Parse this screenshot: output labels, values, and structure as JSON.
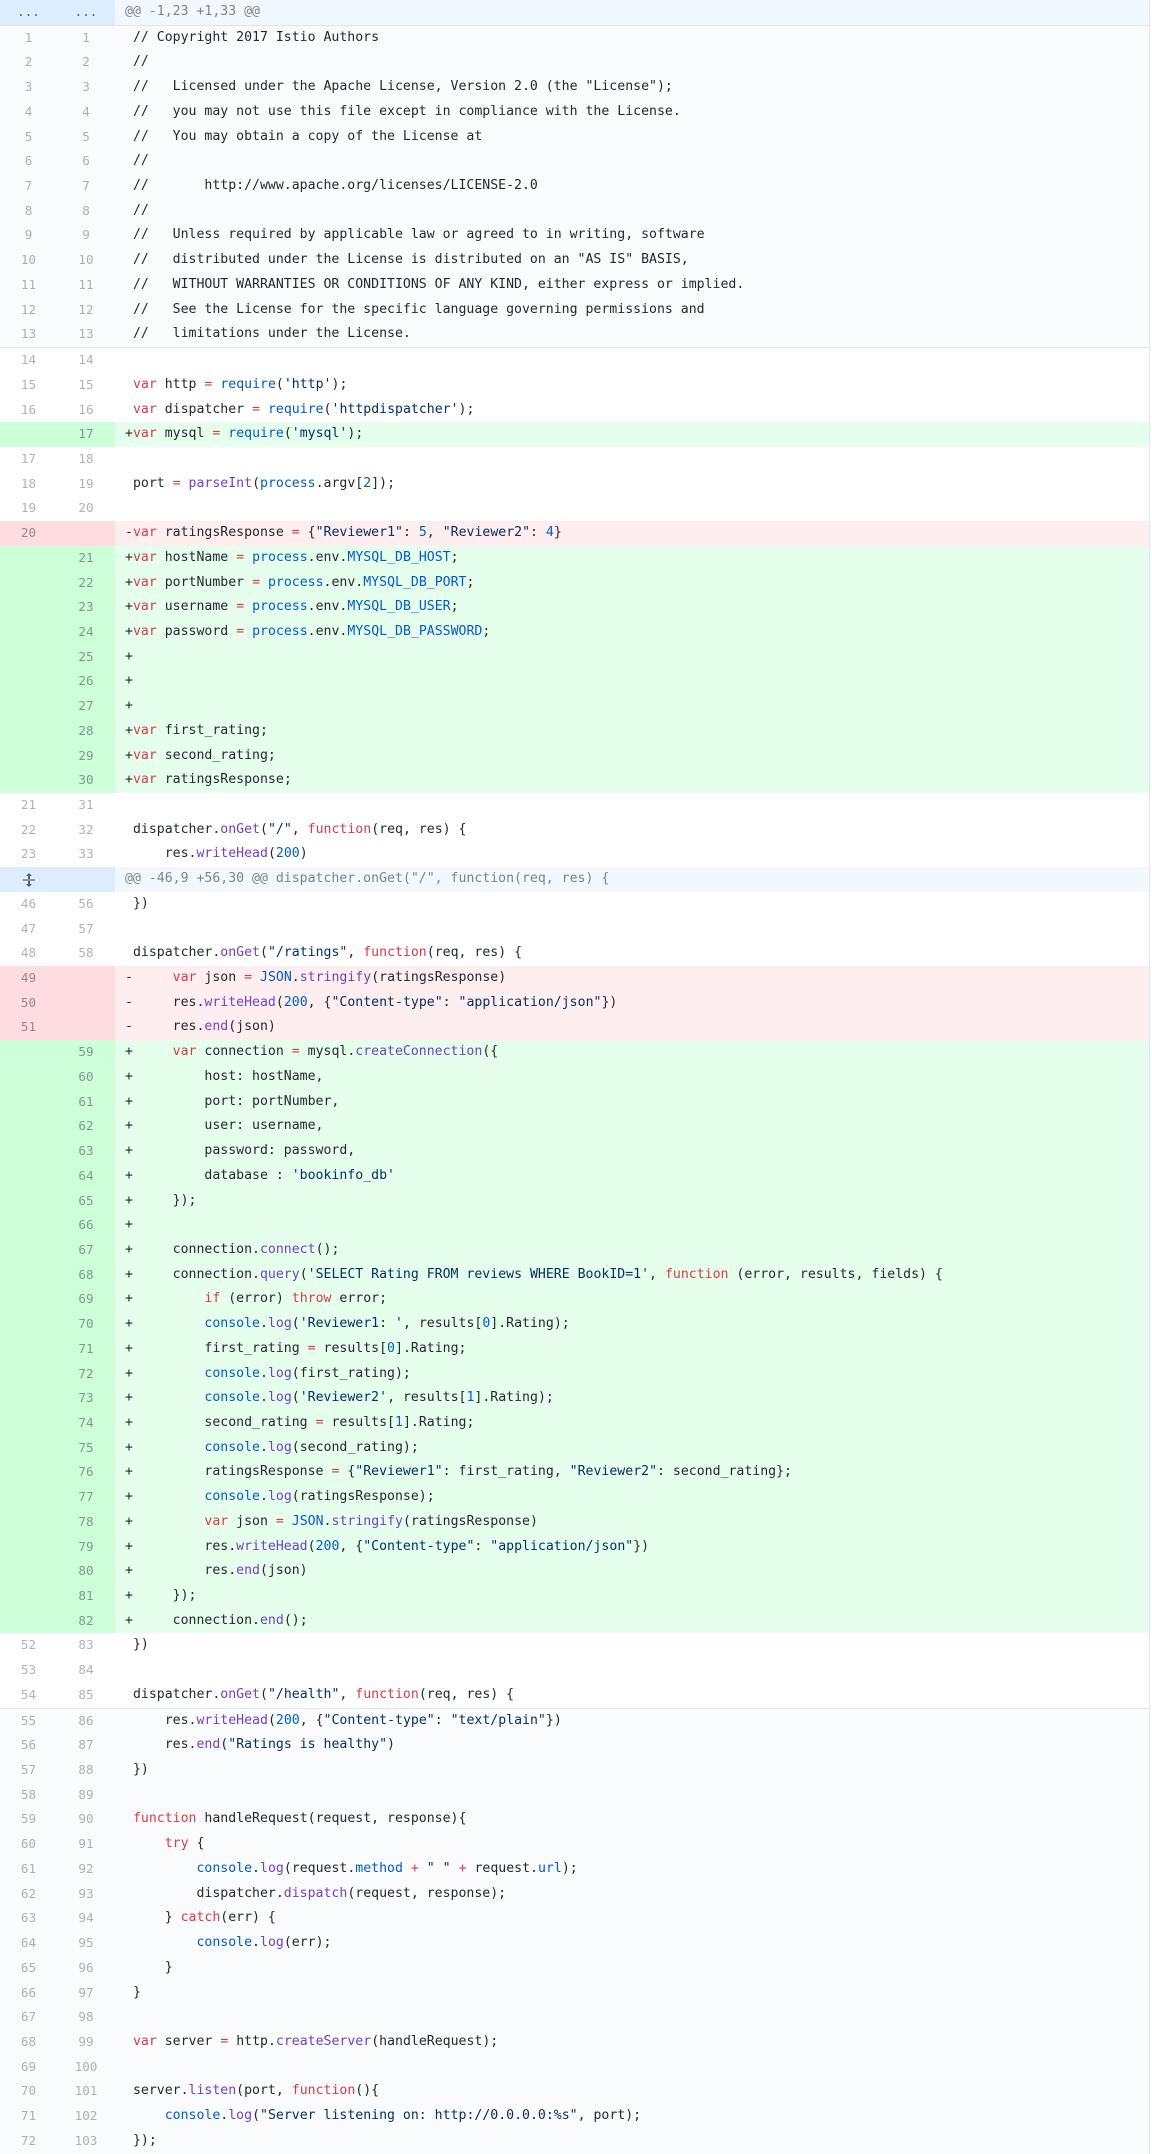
{
  "hunk_header_1": "@@ -1,23 +1,33 @@",
  "hunk_header_2": "@@ -46,9 +56,30 @@ dispatcher.onGet(\"/\", function(req, res) {",
  "expand_glyph_top": "...",
  "expand_icon_name": "unfold-icon",
  "colors": {
    "added_bg": "#e6ffed",
    "added_num_bg": "#cdffd8",
    "deleted_bg": "#ffeef0",
    "deleted_num_bg": "#ffdce0",
    "hunk_bg": "#f1f8ff",
    "keyword": "#d73a49",
    "function": "#6f42c1",
    "string": "#032f62",
    "constant": "#005cc5"
  },
  "lines": [
    {
      "t": "hunk",
      "old": "...",
      "new": "...",
      "code": "@@ -1,23 +1,33 @@"
    },
    {
      "t": "ca",
      "old": "1",
      "new": "1",
      "code": " // Copyright 2017 Istio Authors"
    },
    {
      "t": "ca",
      "old": "2",
      "new": "2",
      "code": " //"
    },
    {
      "t": "ca",
      "old": "3",
      "new": "3",
      "code": " //   Licensed under the Apache License, Version 2.0 (the \"License\");"
    },
    {
      "t": "ca",
      "old": "4",
      "new": "4",
      "code": " //   you may not use this file except in compliance with the License."
    },
    {
      "t": "ca",
      "old": "5",
      "new": "5",
      "code": " //   You may obtain a copy of the License at"
    },
    {
      "t": "ca",
      "old": "6",
      "new": "6",
      "code": " //"
    },
    {
      "t": "ca",
      "old": "7",
      "new": "7",
      "code": " //       http://www.apache.org/licenses/LICENSE-2.0"
    },
    {
      "t": "ca",
      "old": "8",
      "new": "8",
      "code": " //"
    },
    {
      "t": "ca",
      "old": "9",
      "new": "9",
      "code": " //   Unless required by applicable law or agreed to in writing, software"
    },
    {
      "t": "ca",
      "old": "10",
      "new": "10",
      "code": " //   distributed under the License is distributed on an \"AS IS\" BASIS,"
    },
    {
      "t": "ca",
      "old": "11",
      "new": "11",
      "code": " //   WITHOUT WARRANTIES OR CONDITIONS OF ANY KIND, either express or implied."
    },
    {
      "t": "ca",
      "old": "12",
      "new": "12",
      "code": " //   See the License for the specific language governing permissions and"
    },
    {
      "t": "ca",
      "old": "13",
      "new": "13",
      "code": " //   limitations under the License."
    },
    {
      "t": "c",
      "old": "14",
      "new": "14",
      "code": " ",
      "sep": true
    },
    {
      "t": "c",
      "old": "15",
      "new": "15",
      "code": " var http = require('http');"
    },
    {
      "t": "c",
      "old": "16",
      "new": "16",
      "code": " var dispatcher = require('httpdispatcher');"
    },
    {
      "t": "add",
      "old": "",
      "new": "17",
      "code": "+var mysql = require('mysql');"
    },
    {
      "t": "c",
      "old": "17",
      "new": "18",
      "code": " "
    },
    {
      "t": "c",
      "old": "18",
      "new": "19",
      "code": " port = parseInt(process.argv[2]);"
    },
    {
      "t": "c",
      "old": "19",
      "new": "20",
      "code": " "
    },
    {
      "t": "del",
      "old": "20",
      "new": "",
      "code": "-var ratingsResponse = {\"Reviewer1\": 5, \"Reviewer2\": 4}"
    },
    {
      "t": "add",
      "old": "",
      "new": "21",
      "code": "+var hostName = process.env.MYSQL_DB_HOST;"
    },
    {
      "t": "add",
      "old": "",
      "new": "22",
      "code": "+var portNumber = process.env.MYSQL_DB_PORT;"
    },
    {
      "t": "add",
      "old": "",
      "new": "23",
      "code": "+var username = process.env.MYSQL_DB_USER;"
    },
    {
      "t": "add",
      "old": "",
      "new": "24",
      "code": "+var password = process.env.MYSQL_DB_PASSWORD;"
    },
    {
      "t": "add",
      "old": "",
      "new": "25",
      "code": "+"
    },
    {
      "t": "add",
      "old": "",
      "new": "26",
      "code": "+"
    },
    {
      "t": "add",
      "old": "",
      "new": "27",
      "code": "+"
    },
    {
      "t": "add",
      "old": "",
      "new": "28",
      "code": "+var first_rating;"
    },
    {
      "t": "add",
      "old": "",
      "new": "29",
      "code": "+var second_rating;"
    },
    {
      "t": "add",
      "old": "",
      "new": "30",
      "code": "+var ratingsResponse;"
    },
    {
      "t": "c",
      "old": "21",
      "new": "31",
      "code": " "
    },
    {
      "t": "c",
      "old": "22",
      "new": "32",
      "code": " dispatcher.onGet(\"/\", function(req, res) {"
    },
    {
      "t": "c",
      "old": "23",
      "new": "33",
      "code": "     res.writeHead(200)"
    },
    {
      "t": "hunk2",
      "old": "",
      "new": "",
      "code": "@@ -46,9 +56,30 @@ dispatcher.onGet(\"/\", function(req, res) {"
    },
    {
      "t": "c",
      "old": "46",
      "new": "56",
      "code": " })"
    },
    {
      "t": "c",
      "old": "47",
      "new": "57",
      "code": " "
    },
    {
      "t": "c",
      "old": "48",
      "new": "58",
      "code": " dispatcher.onGet(\"/ratings\", function(req, res) {"
    },
    {
      "t": "del",
      "old": "49",
      "new": "",
      "code": "-     var json = JSON.stringify(ratingsResponse)"
    },
    {
      "t": "del",
      "old": "50",
      "new": "",
      "code": "-     res.writeHead(200, {\"Content-type\": \"application/json\"})"
    },
    {
      "t": "del",
      "old": "51",
      "new": "",
      "code": "-     res.end(json)"
    },
    {
      "t": "add",
      "old": "",
      "new": "59",
      "code": "+     var connection = mysql.createConnection({"
    },
    {
      "t": "add",
      "old": "",
      "new": "60",
      "code": "+         host: hostName,"
    },
    {
      "t": "add",
      "old": "",
      "new": "61",
      "code": "+         port: portNumber,"
    },
    {
      "t": "add",
      "old": "",
      "new": "62",
      "code": "+         user: username,"
    },
    {
      "t": "add",
      "old": "",
      "new": "63",
      "code": "+         password: password,"
    },
    {
      "t": "add",
      "old": "",
      "new": "64",
      "code": "+         database : 'bookinfo_db'"
    },
    {
      "t": "add",
      "old": "",
      "new": "65",
      "code": "+     });"
    },
    {
      "t": "add",
      "old": "",
      "new": "66",
      "code": "+"
    },
    {
      "t": "add",
      "old": "",
      "new": "67",
      "code": "+     connection.connect();"
    },
    {
      "t": "add",
      "old": "",
      "new": "68",
      "code": "+     connection.query('SELECT Rating FROM reviews WHERE BookID=1', function (error, results, fields) {"
    },
    {
      "t": "add",
      "old": "",
      "new": "69",
      "code": "+         if (error) throw error;"
    },
    {
      "t": "add",
      "old": "",
      "new": "70",
      "code": "+         console.log('Reviewer1: ', results[0].Rating);"
    },
    {
      "t": "add",
      "old": "",
      "new": "71",
      "code": "+         first_rating = results[0].Rating;"
    },
    {
      "t": "add",
      "old": "",
      "new": "72",
      "code": "+         console.log(first_rating);"
    },
    {
      "t": "add",
      "old": "",
      "new": "73",
      "code": "+         console.log('Reviewer2', results[1].Rating);"
    },
    {
      "t": "add",
      "old": "",
      "new": "74",
      "code": "+         second_rating = results[1].Rating;"
    },
    {
      "t": "add",
      "old": "",
      "new": "75",
      "code": "+         console.log(second_rating);"
    },
    {
      "t": "add",
      "old": "",
      "new": "76",
      "code": "+         ratingsResponse = {\"Reviewer1\": first_rating, \"Reviewer2\": second_rating};"
    },
    {
      "t": "add",
      "old": "",
      "new": "77",
      "code": "+         console.log(ratingsResponse);"
    },
    {
      "t": "add",
      "old": "",
      "new": "78",
      "code": "+         var json = JSON.stringify(ratingsResponse)"
    },
    {
      "t": "add",
      "old": "",
      "new": "79",
      "code": "+         res.writeHead(200, {\"Content-type\": \"application/json\"})"
    },
    {
      "t": "add",
      "old": "",
      "new": "80",
      "code": "+         res.end(json)"
    },
    {
      "t": "add",
      "old": "",
      "new": "81",
      "code": "+     });"
    },
    {
      "t": "add",
      "old": "",
      "new": "82",
      "code": "+     connection.end();"
    },
    {
      "t": "c",
      "old": "52",
      "new": "83",
      "code": " })"
    },
    {
      "t": "c",
      "old": "53",
      "new": "84",
      "code": " "
    },
    {
      "t": "c",
      "old": "54",
      "new": "85",
      "code": " dispatcher.onGet(\"/health\", function(req, res) {"
    },
    {
      "t": "ca",
      "old": "55",
      "new": "86",
      "code": "     res.writeHead(200, {\"Content-type\": \"text/plain\"})",
      "sep": true
    },
    {
      "t": "ca",
      "old": "56",
      "new": "87",
      "code": "     res.end(\"Ratings is healthy\")"
    },
    {
      "t": "ca",
      "old": "57",
      "new": "88",
      "code": " })"
    },
    {
      "t": "ca",
      "old": "58",
      "new": "89",
      "code": " "
    },
    {
      "t": "ca",
      "old": "59",
      "new": "90",
      "code": " function handleRequest(request, response){"
    },
    {
      "t": "ca",
      "old": "60",
      "new": "91",
      "code": "     try {"
    },
    {
      "t": "ca",
      "old": "61",
      "new": "92",
      "code": "         console.log(request.method + \" \" + request.url);"
    },
    {
      "t": "ca",
      "old": "62",
      "new": "93",
      "code": "         dispatcher.dispatch(request, response);"
    },
    {
      "t": "ca",
      "old": "63",
      "new": "94",
      "code": "     } catch(err) {"
    },
    {
      "t": "ca",
      "old": "64",
      "new": "95",
      "code": "         console.log(err);"
    },
    {
      "t": "ca",
      "old": "65",
      "new": "96",
      "code": "     }"
    },
    {
      "t": "ca",
      "old": "66",
      "new": "97",
      "code": " }"
    },
    {
      "t": "ca",
      "old": "67",
      "new": "98",
      "code": " "
    },
    {
      "t": "ca",
      "old": "68",
      "new": "99",
      "code": " var server = http.createServer(handleRequest);"
    },
    {
      "t": "ca",
      "old": "69",
      "new": "100",
      "code": " "
    },
    {
      "t": "ca",
      "old": "70",
      "new": "101",
      "code": " server.listen(port, function(){"
    },
    {
      "t": "ca",
      "old": "71",
      "new": "102",
      "code": "     console.log(\"Server listening on: http://0.0.0.0:%s\", port);"
    },
    {
      "t": "ca",
      "old": "72",
      "new": "103",
      "code": " });"
    }
  ]
}
